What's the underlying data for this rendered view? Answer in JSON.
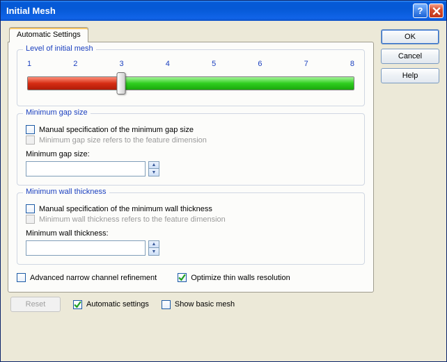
{
  "window": {
    "title": "Initial Mesh"
  },
  "buttons": {
    "ok": "OK",
    "cancel": "Cancel",
    "help": "Help",
    "reset": "Reset"
  },
  "tab": {
    "label": "Automatic Settings"
  },
  "level_group": {
    "legend": "Level of initial mesh",
    "ticks": [
      "1",
      "2",
      "3",
      "4",
      "5",
      "6",
      "7",
      "8"
    ],
    "value_index": 2,
    "min_index": 0,
    "max_index": 7
  },
  "gap_group": {
    "legend": "Minimum gap size",
    "manual_label": "Manual specification of the minimum gap size",
    "manual_checked": false,
    "feature_label": "Minimum gap size refers to the feature dimension",
    "feature_checked": false,
    "field_label": "Minimum gap size:",
    "value": ""
  },
  "wall_group": {
    "legend": "Minimum wall thickness",
    "manual_label": "Manual specification of the minimum wall thickness",
    "manual_checked": false,
    "feature_label": "Minimum wall thickness refers to the feature dimension",
    "feature_checked": false,
    "field_label": "Minimum wall thickness:",
    "value": ""
  },
  "bottom": {
    "adv_label": "Advanced narrow channel refinement",
    "adv_checked": false,
    "opt_label": "Optimize thin walls resolution",
    "opt_checked": true
  },
  "footer": {
    "auto_label": "Automatic settings",
    "auto_checked": true,
    "basic_label": "Show basic mesh",
    "basic_checked": false
  }
}
